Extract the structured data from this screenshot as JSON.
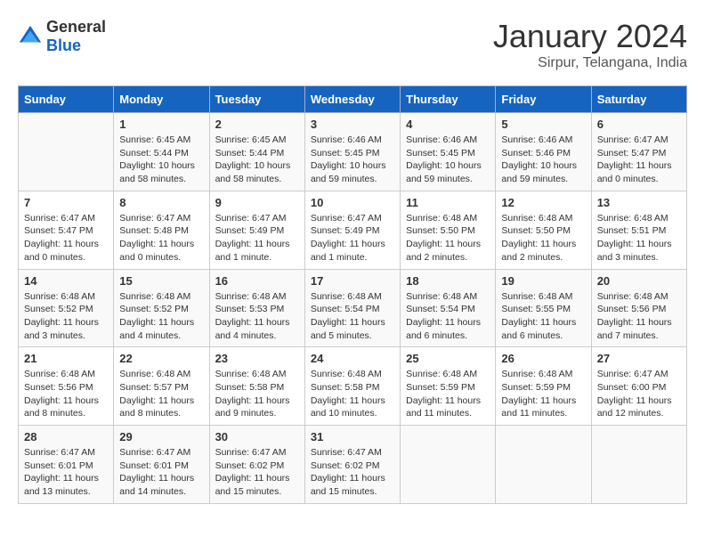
{
  "header": {
    "logo_general": "General",
    "logo_blue": "Blue",
    "month_title": "January 2024",
    "subtitle": "Sirpur, Telangana, India"
  },
  "days_of_week": [
    "Sunday",
    "Monday",
    "Tuesday",
    "Wednesday",
    "Thursday",
    "Friday",
    "Saturday"
  ],
  "weeks": [
    [
      {
        "day": "",
        "info": ""
      },
      {
        "day": "1",
        "info": "Sunrise: 6:45 AM\nSunset: 5:44 PM\nDaylight: 10 hours\nand 58 minutes."
      },
      {
        "day": "2",
        "info": "Sunrise: 6:45 AM\nSunset: 5:44 PM\nDaylight: 10 hours\nand 58 minutes."
      },
      {
        "day": "3",
        "info": "Sunrise: 6:46 AM\nSunset: 5:45 PM\nDaylight: 10 hours\nand 59 minutes."
      },
      {
        "day": "4",
        "info": "Sunrise: 6:46 AM\nSunset: 5:45 PM\nDaylight: 10 hours\nand 59 minutes."
      },
      {
        "day": "5",
        "info": "Sunrise: 6:46 AM\nSunset: 5:46 PM\nDaylight: 10 hours\nand 59 minutes."
      },
      {
        "day": "6",
        "info": "Sunrise: 6:47 AM\nSunset: 5:47 PM\nDaylight: 11 hours\nand 0 minutes."
      }
    ],
    [
      {
        "day": "7",
        "info": "Sunrise: 6:47 AM\nSunset: 5:47 PM\nDaylight: 11 hours\nand 0 minutes."
      },
      {
        "day": "8",
        "info": "Sunrise: 6:47 AM\nSunset: 5:48 PM\nDaylight: 11 hours\nand 0 minutes."
      },
      {
        "day": "9",
        "info": "Sunrise: 6:47 AM\nSunset: 5:49 PM\nDaylight: 11 hours\nand 1 minute."
      },
      {
        "day": "10",
        "info": "Sunrise: 6:47 AM\nSunset: 5:49 PM\nDaylight: 11 hours\nand 1 minute."
      },
      {
        "day": "11",
        "info": "Sunrise: 6:48 AM\nSunset: 5:50 PM\nDaylight: 11 hours\nand 2 minutes."
      },
      {
        "day": "12",
        "info": "Sunrise: 6:48 AM\nSunset: 5:50 PM\nDaylight: 11 hours\nand 2 minutes."
      },
      {
        "day": "13",
        "info": "Sunrise: 6:48 AM\nSunset: 5:51 PM\nDaylight: 11 hours\nand 3 minutes."
      }
    ],
    [
      {
        "day": "14",
        "info": "Sunrise: 6:48 AM\nSunset: 5:52 PM\nDaylight: 11 hours\nand 3 minutes."
      },
      {
        "day": "15",
        "info": "Sunrise: 6:48 AM\nSunset: 5:52 PM\nDaylight: 11 hours\nand 4 minutes."
      },
      {
        "day": "16",
        "info": "Sunrise: 6:48 AM\nSunset: 5:53 PM\nDaylight: 11 hours\nand 4 minutes."
      },
      {
        "day": "17",
        "info": "Sunrise: 6:48 AM\nSunset: 5:54 PM\nDaylight: 11 hours\nand 5 minutes."
      },
      {
        "day": "18",
        "info": "Sunrise: 6:48 AM\nSunset: 5:54 PM\nDaylight: 11 hours\nand 6 minutes."
      },
      {
        "day": "19",
        "info": "Sunrise: 6:48 AM\nSunset: 5:55 PM\nDaylight: 11 hours\nand 6 minutes."
      },
      {
        "day": "20",
        "info": "Sunrise: 6:48 AM\nSunset: 5:56 PM\nDaylight: 11 hours\nand 7 minutes."
      }
    ],
    [
      {
        "day": "21",
        "info": "Sunrise: 6:48 AM\nSunset: 5:56 PM\nDaylight: 11 hours\nand 8 minutes."
      },
      {
        "day": "22",
        "info": "Sunrise: 6:48 AM\nSunset: 5:57 PM\nDaylight: 11 hours\nand 8 minutes."
      },
      {
        "day": "23",
        "info": "Sunrise: 6:48 AM\nSunset: 5:58 PM\nDaylight: 11 hours\nand 9 minutes."
      },
      {
        "day": "24",
        "info": "Sunrise: 6:48 AM\nSunset: 5:58 PM\nDaylight: 11 hours\nand 10 minutes."
      },
      {
        "day": "25",
        "info": "Sunrise: 6:48 AM\nSunset: 5:59 PM\nDaylight: 11 hours\nand 11 minutes."
      },
      {
        "day": "26",
        "info": "Sunrise: 6:48 AM\nSunset: 5:59 PM\nDaylight: 11 hours\nand 11 minutes."
      },
      {
        "day": "27",
        "info": "Sunrise: 6:47 AM\nSunset: 6:00 PM\nDaylight: 11 hours\nand 12 minutes."
      }
    ],
    [
      {
        "day": "28",
        "info": "Sunrise: 6:47 AM\nSunset: 6:01 PM\nDaylight: 11 hours\nand 13 minutes."
      },
      {
        "day": "29",
        "info": "Sunrise: 6:47 AM\nSunset: 6:01 PM\nDaylight: 11 hours\nand 14 minutes."
      },
      {
        "day": "30",
        "info": "Sunrise: 6:47 AM\nSunset: 6:02 PM\nDaylight: 11 hours\nand 15 minutes."
      },
      {
        "day": "31",
        "info": "Sunrise: 6:47 AM\nSunset: 6:02 PM\nDaylight: 11 hours\nand 15 minutes."
      },
      {
        "day": "",
        "info": ""
      },
      {
        "day": "",
        "info": ""
      },
      {
        "day": "",
        "info": ""
      }
    ]
  ]
}
